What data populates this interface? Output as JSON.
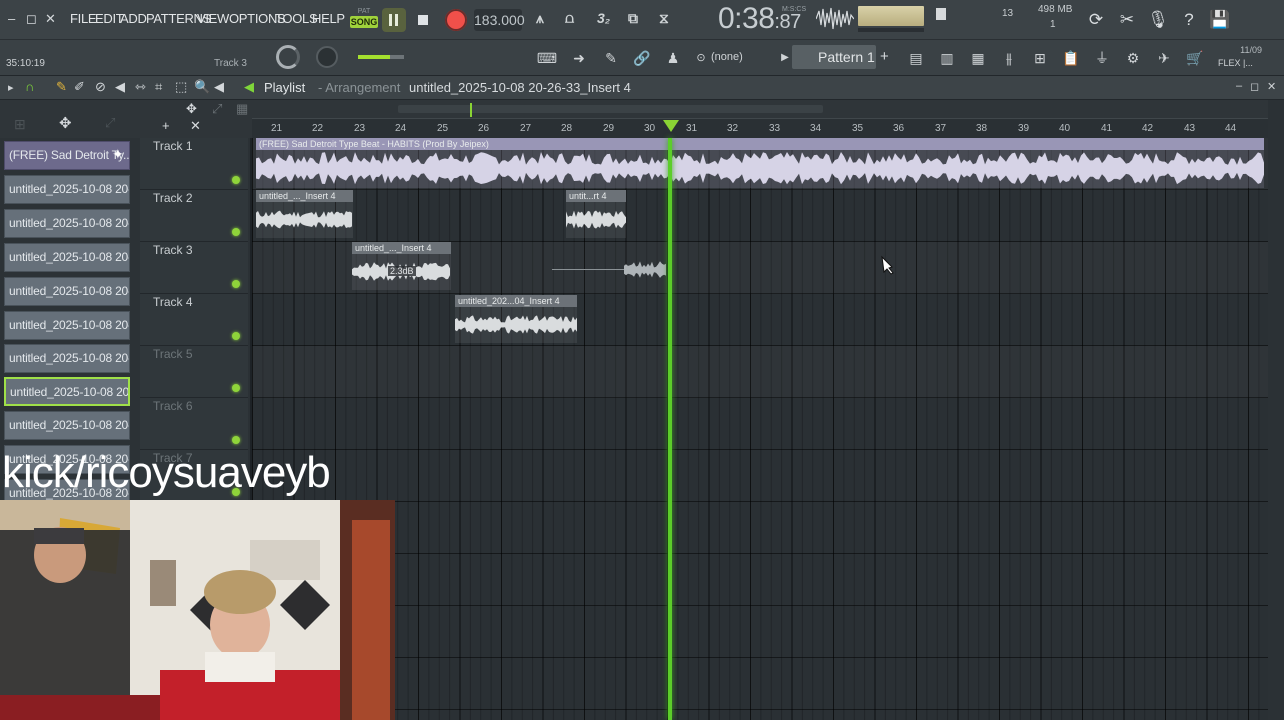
{
  "window_controls": [
    "–",
    "◻",
    "✕"
  ],
  "menu": [
    "FILE",
    "EDIT",
    "ADD",
    "PATTERNS",
    "VIEW",
    "OPTIONS",
    "TOOLS",
    "HELP"
  ],
  "transport": {
    "pat_label": "PAT",
    "song_label": "SONG",
    "tempo": "183.000"
  },
  "time_display": {
    "main": "0:38",
    "frac": ":87",
    "unit": "M:S:CS"
  },
  "cpu": "13",
  "memory": {
    "top": "498 MB",
    "bottom": "1"
  },
  "hint": {
    "time": "35:10:19",
    "track": "Track 3"
  },
  "pattern": {
    "none": "(none)",
    "selected": "Pattern 1",
    "add": "+"
  },
  "top_right": {
    "date": "11/09",
    "flex": "FLEX |..."
  },
  "playlist": {
    "title": "Playlist",
    "sub": "- Arrangement",
    "file": "untitled_2025-10-08 20-26-33_Insert 4"
  },
  "ruler": [
    "21",
    "22",
    "23",
    "24",
    "25",
    "26",
    "27",
    "28",
    "29",
    "30",
    "31",
    "32",
    "33",
    "34",
    "35",
    "36",
    "37",
    "38",
    "39",
    "40",
    "41",
    "42",
    "43",
    "44"
  ],
  "picker": [
    "(FREE) Sad Detroit Ty...",
    "untitled_2025-10-08 20-...",
    "untitled_2025-10-08 20-...",
    "untitled_2025-10-08 20-...",
    "untitled_2025-10-08 20-...",
    "untitled_2025-10-08 20-...",
    "untitled_2025-10-08 20-...",
    "untitled_2025-10-08 20-...",
    "untitled_2025-10-08 20-...",
    "untitled_2025-10-08 20-...",
    "untitled_2025-10-08 20-..."
  ],
  "tracks": [
    "Track 1",
    "Track 2",
    "Track 3",
    "Track 4",
    "Track 5",
    "Track 6",
    "Track 7"
  ],
  "clips": {
    "c1": "(FREE) Sad Detroit Type Beat - HABITS (Prod By Jeipex)",
    "c2a": "untitled_..._Insert 4",
    "c2b": "untit...rt 4",
    "c3": "untitled_..._Insert 4",
    "c4": "untitled_202...04_Insert 4"
  },
  "gain_tip": "2.3dB",
  "watermark": "kick/ricoysuaveyb",
  "colors": {
    "accent": "#8fd43a",
    "record": "#f0504a",
    "song": "#9fd23b"
  }
}
